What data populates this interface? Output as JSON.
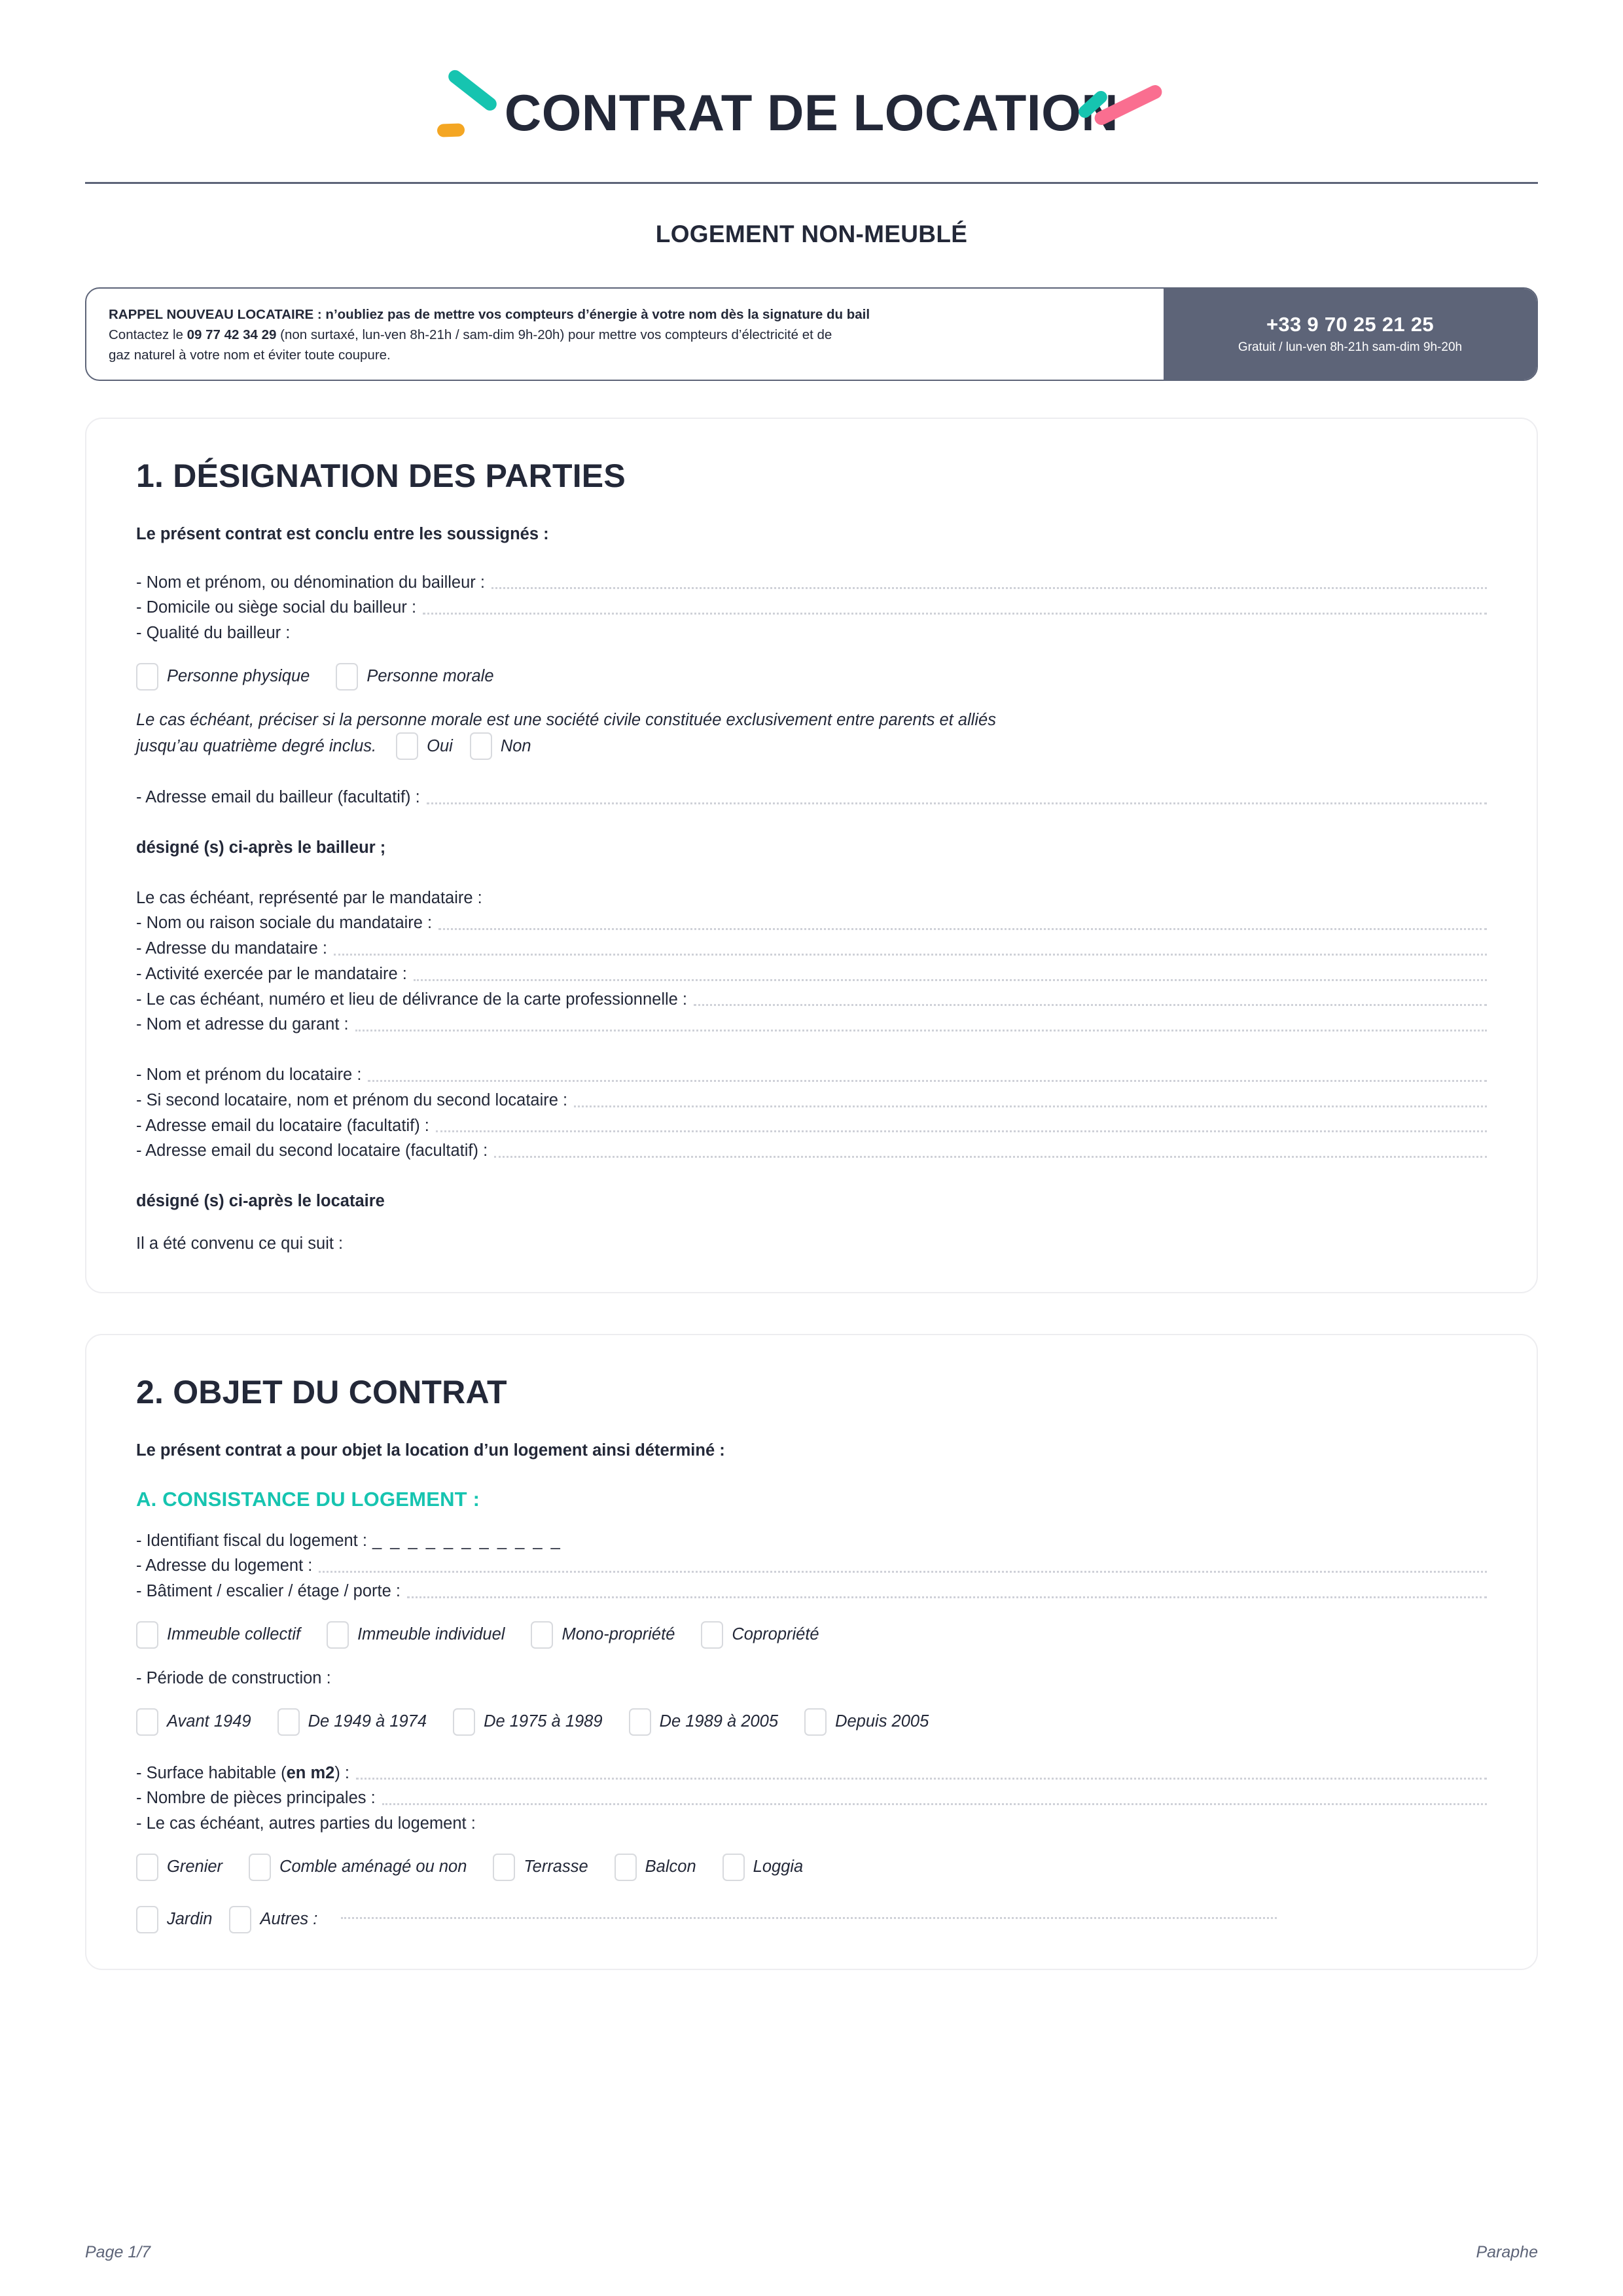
{
  "header": {
    "title": "CONTRAT DE LOCATION",
    "subtitle": "LOGEMENT NON-MEUBLÉ"
  },
  "banner": {
    "line1": "RAPPEL NOUVEAU LOCATAIRE : n’oubliez pas de mettre vos compteurs d’énergie à votre nom dès la signature du bail",
    "line2_a": "Contactez le ",
    "line2_phone": "09 77 42 34 29",
    "line2_b": " (non surtaxé, lun-ven 8h-21h / sam-dim 9h-20h) pour mettre vos compteurs d’électricité et de",
    "line3": "gaz naturel à votre nom et éviter toute coupure.",
    "phone_number": "+33 9 70 25 21 25",
    "phone_sub": "Gratuit / lun-ven 8h-21h sam-dim 9h-20h"
  },
  "section1": {
    "title": "1. DÉSIGNATION DES PARTIES",
    "lead": "Le présent contrat est conclu entre les soussignés :",
    "f_nom_bailleur": "- Nom et prénom, ou dénomination du bailleur :",
    "f_domicile_bailleur": "- Domicile ou siège social du bailleur :",
    "f_qualite_bailleur": "- Qualité du bailleur :",
    "cb_personne_physique": "Personne physique",
    "cb_personne_morale": "Personne morale",
    "note_societe_civile_1": "Le cas échéant, préciser si la personne morale est une société civile constituée exclusivement entre parents et alliés",
    "note_societe_civile_2": "jusqu’au quatrième degré inclus.",
    "cb_oui": "Oui",
    "cb_non": "Non",
    "f_email_bailleur": "- Adresse email du bailleur (facultatif) :",
    "designe_bailleur": "désigné (s) ci-après le bailleur ;",
    "mandataire_intro": "Le cas échéant, représenté par le mandataire :",
    "f_nom_mandataire": "- Nom ou raison sociale du mandataire :",
    "f_adresse_mandataire": "- Adresse du mandataire :",
    "f_activite_mandataire": "- Activité exercée par le mandataire :",
    "f_carte_pro": "- Le cas échéant, numéro et lieu de délivrance de la carte professionnelle :",
    "f_garant": "- Nom et adresse du garant :",
    "f_nom_locataire": "- Nom et prénom du locataire :",
    "f_second_locataire": "- Si second locataire, nom et prénom du second locataire :",
    "f_email_locataire": "- Adresse email du locataire (facultatif) :",
    "f_email_second_locataire": "- Adresse email du second locataire (facultatif) :",
    "designe_locataire": "désigné (s) ci-après le locataire",
    "convenu": "Il a été convenu ce qui suit :"
  },
  "section2": {
    "title": "2. OBJET DU CONTRAT",
    "lead": "Le présent contrat a pour objet la location d’un logement ainsi déterminé :",
    "sub_a_title": "A. CONSISTANCE DU LOGEMENT :",
    "f_identifiant_fiscal": "- Identifiant fiscal du logement :",
    "identifiant_placeholder": "_ _ _ _ _ _ _ _ _ _ _",
    "f_adresse_logement": "- Adresse du logement :",
    "f_batiment": "- Bâtiment / escalier / étage / porte :",
    "cb_immeuble": [
      "Immeuble collectif",
      "Immeuble individuel",
      "Mono-propriété",
      "Copropriété"
    ],
    "f_periode_construction": "- Période de construction :",
    "cb_periodes": [
      "Avant 1949",
      "De 1949 à 1974",
      "De 1975 à 1989",
      "De 1989 à 2005",
      "Depuis 2005"
    ],
    "f_surface_a": "- Surface habitable (",
    "f_surface_bold": "en m2",
    "f_surface_b": ") :",
    "f_nombre_pieces": "- Nombre de pièces principales :",
    "f_autres_parties": "- Le cas échéant, autres parties du logement :",
    "cb_parties": [
      "Grenier",
      "Comble aménagé ou non",
      "Terrasse",
      "Balcon",
      "Loggia"
    ],
    "cb_jardin": "Jardin",
    "cb_autres": "Autres :"
  },
  "footer": {
    "page": "Page 1/7",
    "paraphe": "Paraphe"
  },
  "colors": {
    "ink": "#232838",
    "teal": "#16c4b0",
    "orange": "#f4a623",
    "pink": "#fa6e90",
    "slate": "#5d6478",
    "dots": "#cfd1d8"
  }
}
